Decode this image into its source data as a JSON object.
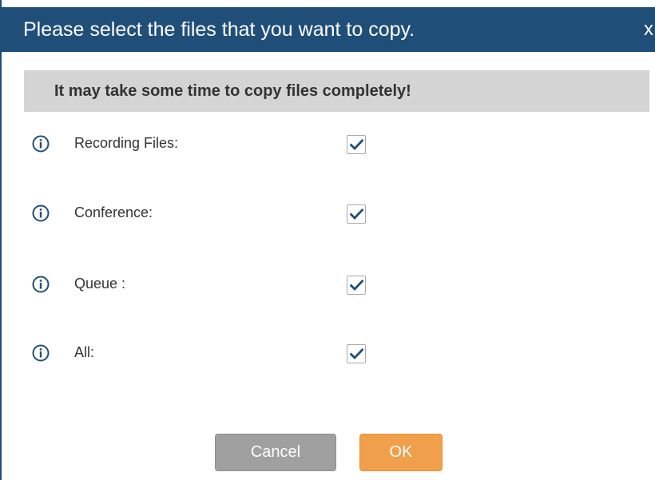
{
  "dialog": {
    "title": "Please select the files that you want to copy.",
    "close_label": "x",
    "notice": "It may take some time to copy files completely!"
  },
  "options": [
    {
      "label": "Recording Files:",
      "checked": true
    },
    {
      "label": "Conference:",
      "checked": true
    },
    {
      "label": "Queue :",
      "checked": true
    },
    {
      "label": "All:",
      "checked": true
    }
  ],
  "buttons": {
    "cancel_label": "Cancel",
    "ok_label": "OK"
  },
  "colors": {
    "titlebar": "#1f4e79",
    "notice_bg": "#d4d4d4",
    "info_icon": "#1f4e79",
    "checkmark": "#1f4e79",
    "cancel_bg": "#a0a0a0",
    "ok_bg": "#f0a04b"
  },
  "icons": {
    "info": "info-circle-icon",
    "check": "checkmark-icon"
  }
}
